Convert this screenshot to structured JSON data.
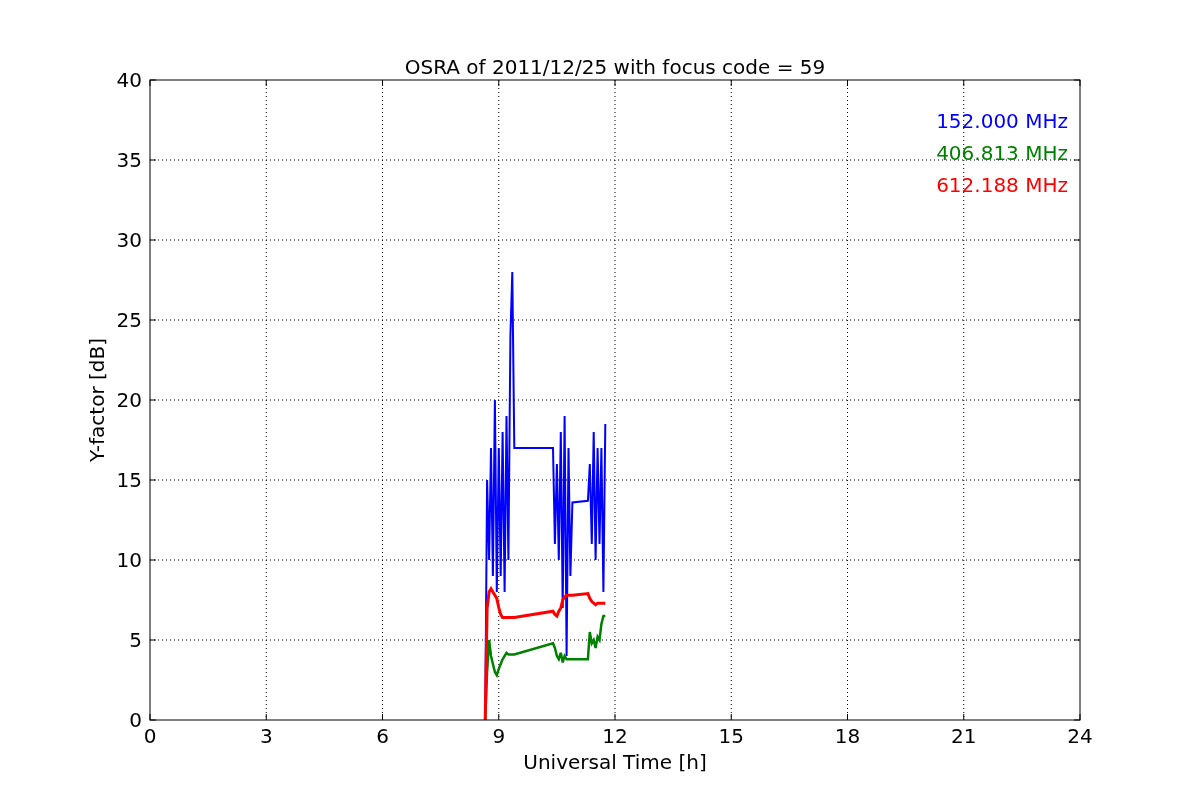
{
  "chart_data": {
    "type": "line",
    "title": "OSRA of 2011/12/25 with focus code = 59",
    "xlabel": "Universal Time [h]",
    "ylabel": "Y-factor [dB]",
    "x": [
      8.65,
      8.7,
      8.75,
      8.8,
      8.85,
      8.9,
      8.95,
      9.0,
      9.05,
      9.1,
      9.15,
      9.2,
      9.25,
      9.3,
      9.35,
      9.4,
      10.4,
      10.45,
      10.5,
      10.55,
      10.6,
      10.65,
      10.7,
      10.75,
      10.8,
      10.85,
      10.9,
      11.3,
      11.35,
      11.4,
      11.45,
      11.5,
      11.55,
      11.6,
      11.65,
      11.7,
      11.75
    ],
    "series": [
      {
        "name": "152.000 MHz",
        "color": "#0000ff",
        "values": [
          0,
          15,
          10,
          17,
          9,
          20,
          8,
          17,
          9,
          18,
          8,
          19,
          10,
          24,
          28,
          17,
          17,
          11,
          16,
          10,
          18,
          7,
          19,
          4,
          17,
          9,
          13.6,
          13.7,
          16,
          11,
          18,
          10,
          17,
          11,
          17,
          8,
          18.5
        ]
      },
      {
        "name": "406.813 MHz",
        "color": "#008000",
        "values": [
          0,
          3,
          5,
          4,
          3.5,
          3,
          2.8,
          3.2,
          3.5,
          3.8,
          4,
          4.2,
          4.1,
          4.1,
          4.1,
          4.1,
          4.8,
          4.5,
          4,
          3.8,
          4.2,
          3.6,
          4,
          3.8,
          3.8,
          3.8,
          3.8,
          3.8,
          5.5,
          4.8,
          5,
          4.5,
          5.2,
          5,
          6,
          6.5,
          6.5
        ]
      },
      {
        "name": "612.188 MHz",
        "color": "#ff0000",
        "values": [
          0,
          7,
          8,
          8.2,
          8,
          7.8,
          7.6,
          7,
          6.6,
          6.4,
          6.4,
          6.4,
          6.4,
          6.4,
          6.4,
          6.4,
          6.8,
          6.6,
          6.5,
          6.8,
          7,
          7.5,
          7.7,
          7.8,
          7.8,
          7.8,
          7.8,
          7.9,
          7.6,
          7.4,
          7.3,
          7.2,
          7.3,
          7.3,
          7.3,
          7.3,
          7.3
        ]
      }
    ],
    "grid": true,
    "xlim": [
      0,
      24
    ],
    "ylim": [
      0,
      40
    ],
    "xticks": [
      0,
      3,
      6,
      9,
      12,
      15,
      18,
      21,
      24
    ],
    "yticks": [
      0,
      5,
      10,
      15,
      20,
      25,
      30,
      35,
      40
    ]
  }
}
